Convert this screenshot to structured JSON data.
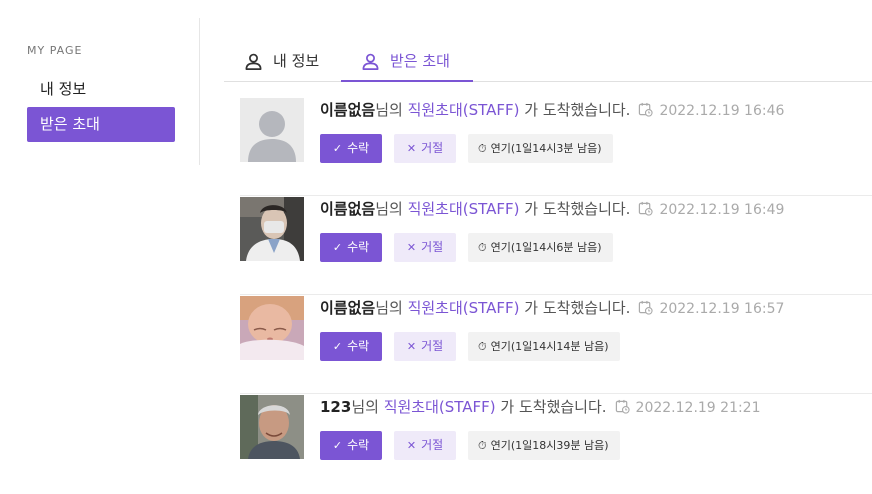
{
  "sidebar": {
    "title": "MY PAGE",
    "items": [
      {
        "label": "내 정보",
        "active": false
      },
      {
        "label": "받은 초대",
        "active": true
      }
    ]
  },
  "tabs": [
    {
      "label": "내 정보",
      "icon": "user-icon",
      "active": false
    },
    {
      "label": "받은 초대",
      "icon": "user-icon",
      "active": true
    }
  ],
  "accent_color": "#7b55d4",
  "buttons": {
    "accept": "수락",
    "reject": "거절"
  },
  "invitations": [
    {
      "name": "이름없음",
      "suffix": "님의 ",
      "invite_type": "직원초대(STAFF)",
      "message_tail": " 가 도착했습니다.",
      "timestamp": "2022.12.19 16:46",
      "extend": "연기(1일14시3분 남음)",
      "avatar": "default-avatar"
    },
    {
      "name": "이름없음",
      "suffix": "님의 ",
      "invite_type": "직원초대(STAFF)",
      "message_tail": " 가 도착했습니다.",
      "timestamp": "2022.12.19 16:49",
      "extend": "연기(1일14시6분 남음)",
      "avatar": "photo-person-mask"
    },
    {
      "name": "이름없음",
      "suffix": "님의 ",
      "invite_type": "직원초대(STAFF)",
      "message_tail": " 가 도착했습니다.",
      "timestamp": "2022.12.19 16:57",
      "extend": "연기(1일14시14분 남음)",
      "avatar": "photo-baby"
    },
    {
      "name": "123",
      "suffix": "님의 ",
      "invite_type": "직원초대(STAFF)",
      "message_tail": " 가 도착했습니다.",
      "timestamp": "2022.12.19 21:21",
      "extend": "연기(1일18시39분 남음)",
      "avatar": "photo-elderly-man"
    }
  ]
}
